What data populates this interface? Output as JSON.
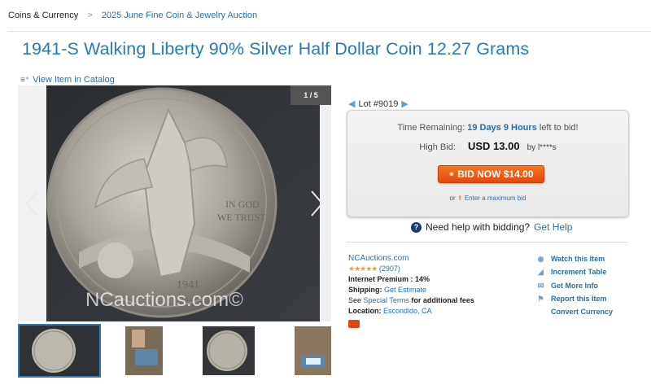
{
  "breadcrumb": {
    "root": "Coins & Currency",
    "sep": ">",
    "current": "2025 June Fine Coin & Jewelry Auction"
  },
  "title": "1941-S Walking Liberty 90% Silver Half Dollar Coin 12.27 Grams",
  "catalog_link": "View Item in Catalog",
  "gallery": {
    "counter": "1 / 5",
    "watermark": "NCauctions.com©"
  },
  "lot": "Lot #9019",
  "bid": {
    "time_label": "Time Remaining:",
    "time_value": "19 Days 9 Hours",
    "time_suffix": "left to bid!",
    "high_label": "High Bid:",
    "high_amount": "USD 13.00",
    "high_by": "by l****s",
    "button": "BID NOW $14.00",
    "max_prefix": "or",
    "max_link": "Enter a maximum bid"
  },
  "help": {
    "text": "Need help with bidding?",
    "link": "Get Help"
  },
  "seller": {
    "name": "NCAuctions.com",
    "stars": "★★★★★",
    "rating_count": "(2907)",
    "premium_label": "Internet Premium :",
    "premium_value": "14%",
    "shipping_label": "Shipping:",
    "shipping_link": "Get Estimate",
    "see": "See",
    "special_terms": "Special Terms",
    "fees": "for additional fees",
    "location_label": "Location:",
    "location_value": "Escondido, CA"
  },
  "actions": [
    "Watch this Item",
    "Increment Table",
    "Get More Info",
    "Report this Item",
    "Convert Currency"
  ],
  "colors": {
    "link": "#2a6fa8",
    "title": "#2a7bb3",
    "bid_button": "#e8561a",
    "stars": "#f0a020"
  }
}
